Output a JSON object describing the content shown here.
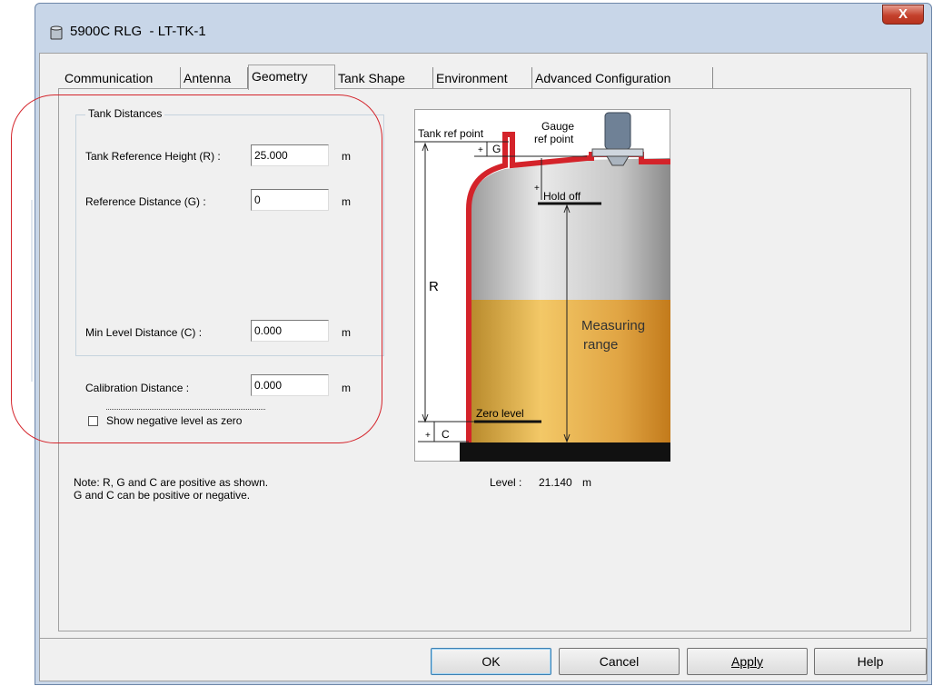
{
  "window": {
    "title": "5900C RLG  - LT-TK-1",
    "close_label": "X",
    "accent": "#c4412c"
  },
  "tabs": [
    {
      "label": "Communication",
      "active": false
    },
    {
      "label": "Antenna",
      "active": false
    },
    {
      "label": "Geometry",
      "active": true
    },
    {
      "label": "Tank Shape",
      "active": false
    },
    {
      "label": "Environment",
      "active": false
    },
    {
      "label": "Advanced Configuration",
      "active": false
    }
  ],
  "tank_distances": {
    "title": "Tank Distances",
    "tank_ref_height": {
      "label": "Tank Reference Height (R) :",
      "value": "25.000",
      "unit": "m"
    },
    "ref_distance": {
      "label": "Reference Distance (G) :",
      "value": "0",
      "unit": "m"
    },
    "min_level_distance": {
      "label": "Min Level Distance (C) :",
      "value": "0.000",
      "unit": "m"
    }
  },
  "calibration": {
    "label": "Calibration Distance :",
    "value": "0.000",
    "unit": "m"
  },
  "show_negative": {
    "label": "Show negative level as zero",
    "checked": false
  },
  "note": {
    "line1": "Note: R, G and C are positive as shown.",
    "line2": "G and C can be positive or negative."
  },
  "diagram": {
    "tank_ref_point": "Tank ref point",
    "gauge_ref_1": "Gauge",
    "gauge_ref_2": "ref point",
    "g_mark": "G",
    "plus": "+",
    "hold_off": "Hold off",
    "r_mark": "R",
    "measuring_1": "Measuring",
    "measuring_2": "range",
    "zero_level": "Zero level",
    "c_mark": "C"
  },
  "level": {
    "label": "Level :",
    "value": "21.140",
    "unit": "m"
  },
  "buttons": {
    "ok": "OK",
    "cancel": "Cancel",
    "apply": "Apply",
    "help": "Help"
  }
}
